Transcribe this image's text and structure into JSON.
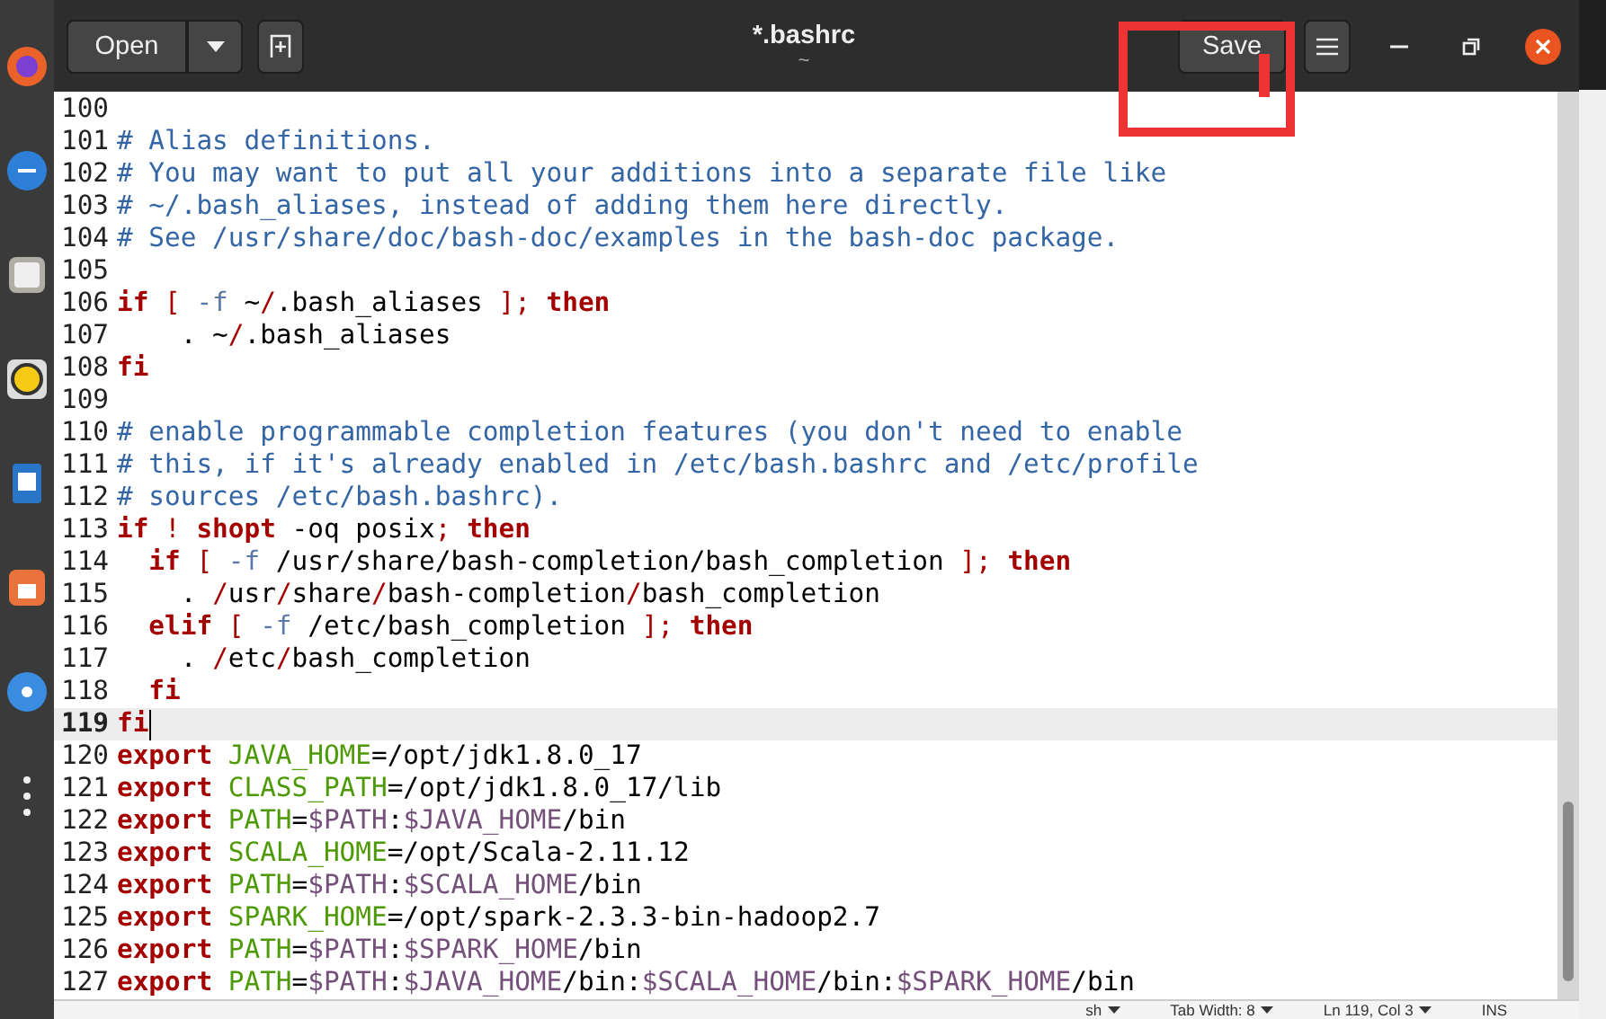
{
  "header": {
    "open_button": "Open",
    "title": "*.bashrc",
    "subtitle": "~",
    "save_button": "Save"
  },
  "annotation": {
    "kind": "rectangle",
    "color": "#ee3333"
  },
  "editor": {
    "lines": [
      {
        "number": "100",
        "current": false
      },
      {
        "number": "101",
        "current": false,
        "tokens": [
          {
            "kind": "comment",
            "text": "# Alias definitions."
          }
        ]
      },
      {
        "number": "102",
        "current": false,
        "tokens": [
          {
            "kind": "comment",
            "text": "# You may want to put all your additions into a separate file like"
          }
        ]
      },
      {
        "number": "103",
        "current": false,
        "tokens": [
          {
            "kind": "comment",
            "text": "# ~/.bash_aliases, instead of adding them here directly."
          }
        ]
      },
      {
        "number": "104",
        "current": false,
        "tokens": [
          {
            "kind": "comment",
            "text": "# See /usr/share/doc/bash-doc/examples in the bash-doc package."
          }
        ]
      },
      {
        "number": "105",
        "current": false
      },
      {
        "number": "106",
        "current": false,
        "tokens": [
          {
            "kind": "keyword",
            "text": "if "
          },
          {
            "kind": "operator",
            "text": "[ "
          },
          {
            "kind": "option",
            "text": "-f"
          },
          {
            "kind": "plain",
            "text": " ~"
          },
          {
            "kind": "operator",
            "text": "/"
          },
          {
            "kind": "plain",
            "text": ".bash_aliases "
          },
          {
            "kind": "operator",
            "text": "]; "
          },
          {
            "kind": "keyword",
            "text": "then"
          }
        ]
      },
      {
        "number": "107",
        "current": false,
        "tokens": [
          {
            "kind": "plain",
            "text": "    . ~"
          },
          {
            "kind": "operator",
            "text": "/"
          },
          {
            "kind": "plain",
            "text": ".bash_aliases"
          }
        ]
      },
      {
        "number": "108",
        "current": false,
        "tokens": [
          {
            "kind": "keyword",
            "text": "fi"
          }
        ]
      },
      {
        "number": "109",
        "current": false
      },
      {
        "number": "110",
        "current": false,
        "tokens": [
          {
            "kind": "comment",
            "text": "# enable programmable completion features (you don't need to enable"
          }
        ]
      },
      {
        "number": "111",
        "current": false,
        "tokens": [
          {
            "kind": "comment",
            "text": "# this, if it's already enabled in /etc/bash.bashrc and /etc/profile"
          }
        ]
      },
      {
        "number": "112",
        "current": false,
        "tokens": [
          {
            "kind": "comment",
            "text": "# sources /etc/bash.bashrc)."
          }
        ]
      },
      {
        "number": "113",
        "current": false,
        "tokens": [
          {
            "kind": "keyword",
            "text": "if "
          },
          {
            "kind": "operator",
            "text": "! "
          },
          {
            "kind": "keyword",
            "text": "shopt"
          },
          {
            "kind": "plain",
            "text": " -oq posix"
          },
          {
            "kind": "operator",
            "text": "; "
          },
          {
            "kind": "keyword",
            "text": "then"
          }
        ]
      },
      {
        "number": "114",
        "current": false,
        "tokens": [
          {
            "kind": "keyword",
            "text": "  if "
          },
          {
            "kind": "operator",
            "text": "[ "
          },
          {
            "kind": "option",
            "text": "-f"
          },
          {
            "kind": "plain",
            "text": " /usr/share/bash-completion/bash_completion "
          },
          {
            "kind": "operator",
            "text": "]; "
          },
          {
            "kind": "keyword",
            "text": "then"
          }
        ]
      },
      {
        "number": "115",
        "current": false,
        "tokens": [
          {
            "kind": "plain",
            "text": "    . "
          },
          {
            "kind": "operator",
            "text": "/"
          },
          {
            "kind": "plain",
            "text": "usr"
          },
          {
            "kind": "operator",
            "text": "/"
          },
          {
            "kind": "plain",
            "text": "share"
          },
          {
            "kind": "operator",
            "text": "/"
          },
          {
            "kind": "plain",
            "text": "bash-completion"
          },
          {
            "kind": "operator",
            "text": "/"
          },
          {
            "kind": "plain",
            "text": "bash_completion"
          }
        ]
      },
      {
        "number": "116",
        "current": false,
        "tokens": [
          {
            "kind": "keyword",
            "text": "  elif "
          },
          {
            "kind": "operator",
            "text": "[ "
          },
          {
            "kind": "option",
            "text": "-f"
          },
          {
            "kind": "plain",
            "text": " /etc/bash_completion "
          },
          {
            "kind": "operator",
            "text": "]; "
          },
          {
            "kind": "keyword",
            "text": "then"
          }
        ]
      },
      {
        "number": "117",
        "current": false,
        "tokens": [
          {
            "kind": "plain",
            "text": "    . "
          },
          {
            "kind": "operator",
            "text": "/"
          },
          {
            "kind": "plain",
            "text": "etc"
          },
          {
            "kind": "operator",
            "text": "/"
          },
          {
            "kind": "plain",
            "text": "bash_completion"
          }
        ]
      },
      {
        "number": "118",
        "current": false,
        "tokens": [
          {
            "kind": "keyword",
            "text": "  fi"
          }
        ]
      },
      {
        "number": "119",
        "current": true,
        "tokens": [
          {
            "kind": "keyword",
            "text": "fi"
          }
        ]
      },
      {
        "number": "120",
        "current": false,
        "tokens": [
          {
            "kind": "keyword",
            "text": "export "
          },
          {
            "kind": "variable",
            "text": "JAVA_HOME"
          },
          {
            "kind": "plain",
            "text": "=/opt/jdk1.8.0_17"
          }
        ]
      },
      {
        "number": "121",
        "current": false,
        "tokens": [
          {
            "kind": "keyword",
            "text": "export "
          },
          {
            "kind": "variable",
            "text": "CLASS_PATH"
          },
          {
            "kind": "plain",
            "text": "=/opt/jdk1.8.0_17/lib"
          }
        ]
      },
      {
        "number": "122",
        "current": false,
        "tokens": [
          {
            "kind": "keyword",
            "text": "export "
          },
          {
            "kind": "variable",
            "text": "PATH"
          },
          {
            "kind": "plain",
            "text": "="
          },
          {
            "kind": "reference",
            "text": "$PATH"
          },
          {
            "kind": "plain",
            "text": ":"
          },
          {
            "kind": "reference",
            "text": "$JAVA_HOME"
          },
          {
            "kind": "plain",
            "text": "/bin"
          }
        ]
      },
      {
        "number": "123",
        "current": false,
        "tokens": [
          {
            "kind": "keyword",
            "text": "export "
          },
          {
            "kind": "variable",
            "text": "SCALA_HOME"
          },
          {
            "kind": "plain",
            "text": "=/opt/Scala-2.11.12"
          }
        ]
      },
      {
        "number": "124",
        "current": false,
        "tokens": [
          {
            "kind": "keyword",
            "text": "export "
          },
          {
            "kind": "variable",
            "text": "PATH"
          },
          {
            "kind": "plain",
            "text": "="
          },
          {
            "kind": "reference",
            "text": "$PATH"
          },
          {
            "kind": "plain",
            "text": ":"
          },
          {
            "kind": "reference",
            "text": "$SCALA_HOME"
          },
          {
            "kind": "plain",
            "text": "/bin"
          }
        ]
      },
      {
        "number": "125",
        "current": false,
        "tokens": [
          {
            "kind": "keyword",
            "text": "export "
          },
          {
            "kind": "variable",
            "text": "SPARK_HOME"
          },
          {
            "kind": "plain",
            "text": "=/opt/spark-2.3.3-bin-hadoop2.7"
          }
        ]
      },
      {
        "number": "126",
        "current": false,
        "tokens": [
          {
            "kind": "keyword",
            "text": "export "
          },
          {
            "kind": "variable",
            "text": "PATH"
          },
          {
            "kind": "plain",
            "text": "="
          },
          {
            "kind": "reference",
            "text": "$PATH"
          },
          {
            "kind": "plain",
            "text": ":"
          },
          {
            "kind": "reference",
            "text": "$SPARK_HOME"
          },
          {
            "kind": "plain",
            "text": "/bin"
          }
        ]
      },
      {
        "number": "127",
        "current": false,
        "tokens": [
          {
            "kind": "keyword",
            "text": "export "
          },
          {
            "kind": "variable",
            "text": "PATH"
          },
          {
            "kind": "plain",
            "text": "="
          },
          {
            "kind": "reference",
            "text": "$PATH"
          },
          {
            "kind": "plain",
            "text": ":"
          },
          {
            "kind": "reference",
            "text": "$JAVA_HOME"
          },
          {
            "kind": "plain",
            "text": "/bin:"
          },
          {
            "kind": "reference",
            "text": "$SCALA_HOME"
          },
          {
            "kind": "plain",
            "text": "/bin:"
          },
          {
            "kind": "reference",
            "text": "$SPARK_HOME"
          },
          {
            "kind": "plain",
            "text": "/bin"
          }
        ]
      }
    ]
  },
  "status_bar": [
    {
      "text": "sh",
      "dropdown": true
    },
    {
      "text": "Tab Width: 8",
      "dropdown": true
    },
    {
      "text": "Ln 119, Col 3",
      "dropdown": true
    },
    {
      "text": "INS",
      "dropdown": false
    }
  ]
}
